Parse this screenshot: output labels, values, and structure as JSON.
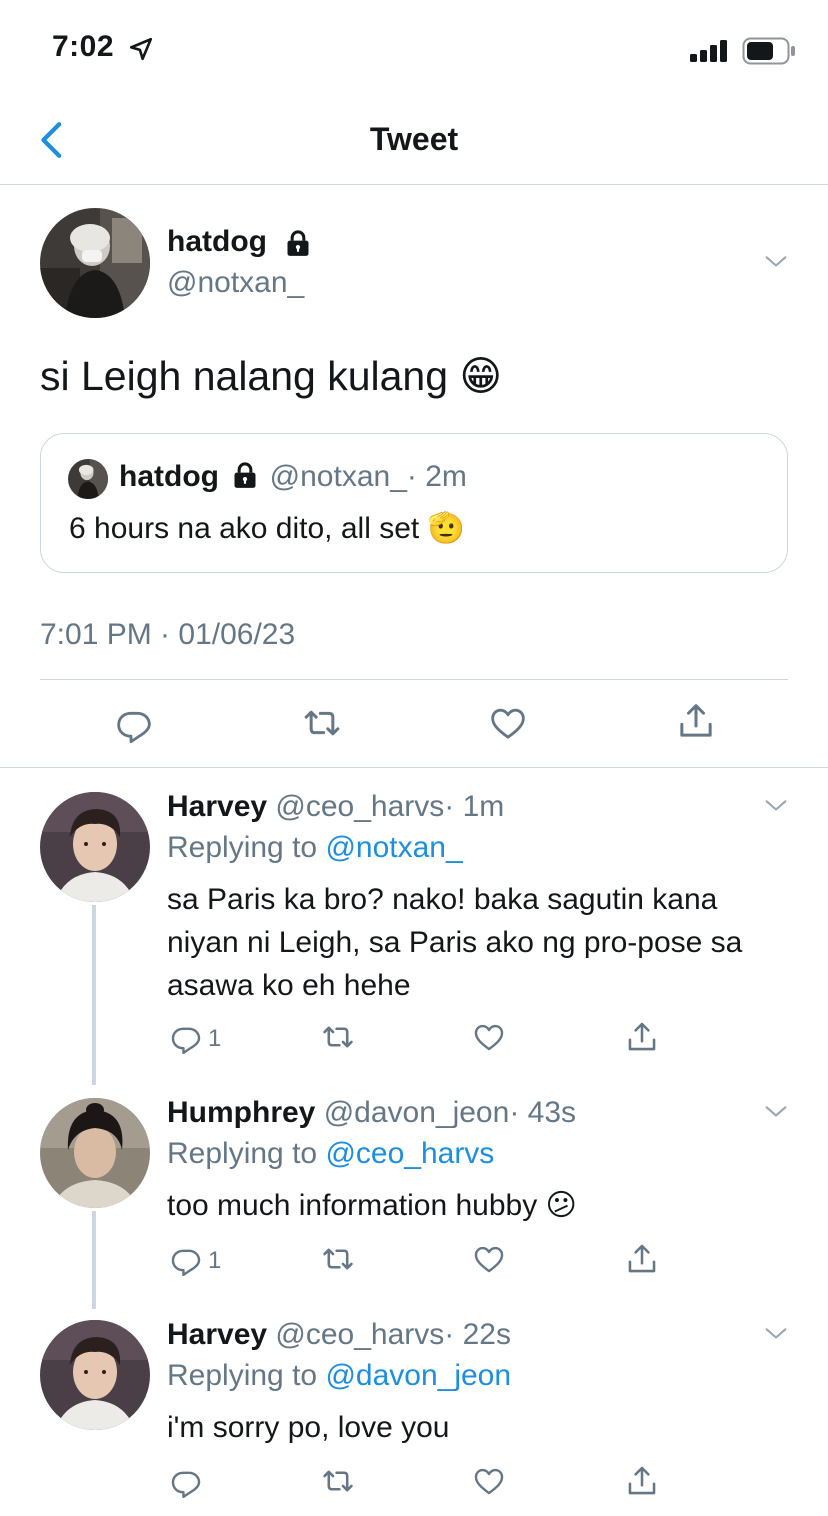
{
  "status_bar": {
    "time": "7:02"
  },
  "nav": {
    "title": "Tweet"
  },
  "main_tweet": {
    "author_name": "hatdog",
    "author_handle": "@notxan_",
    "text": "si Leigh nalang kulang 😁",
    "timestamp": "7:01 PM · 01/06/23",
    "quote": {
      "author_name": "hatdog",
      "author_handle": "@notxan_",
      "time": "· 2m",
      "text": "6 hours na ako dito, all set 🫡"
    }
  },
  "replies": [
    {
      "author_name": "Harvey",
      "author_handle": "@ceo_harvs",
      "time": "· 1m",
      "replying_prefix": "Replying to ",
      "replying_to": "@notxan_",
      "text": "sa Paris ka bro? nako! baka sagutin kana niyan ni Leigh, sa Paris ako ng pro-pose sa asawa ko eh hehe",
      "reply_count": "1"
    },
    {
      "author_name": "Humphrey",
      "author_handle": "@davon_jeon",
      "time": "· 43s",
      "replying_prefix": "Replying to ",
      "replying_to": "@ceo_harvs",
      "text": "too much information hubby 😕",
      "reply_count": "1"
    },
    {
      "author_name": "Harvey",
      "author_handle": "@ceo_harvs",
      "time": "· 22s",
      "replying_prefix": "Replying to ",
      "replying_to": "@davon_jeon",
      "text": "i'm sorry po, love you",
      "reply_count": ""
    }
  ],
  "icons": {
    "back": "chevron-left-icon",
    "lock": "lock-icon",
    "more": "chevron-down-icon",
    "reply": "reply-icon",
    "retweet": "retweet-icon",
    "like": "heart-icon",
    "share": "share-icon"
  },
  "colors": {
    "link": "#1d8fe0",
    "secondary": "#657786",
    "icon": "#657786",
    "divider": "#ced5db"
  }
}
